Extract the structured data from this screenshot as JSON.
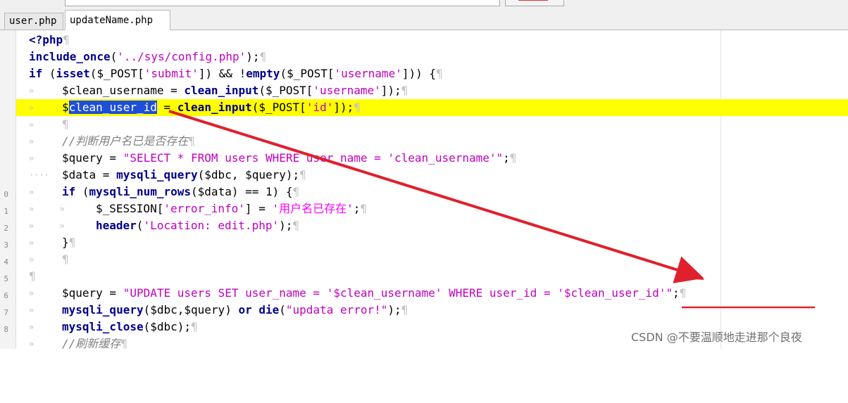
{
  "tabs": [
    {
      "label": "user.php",
      "active": false
    },
    {
      "label": "updateName.php",
      "active": true
    }
  ],
  "gutter_numbers": [
    "0",
    "1",
    "2",
    "3",
    "4",
    "5",
    "6",
    "7",
    "8"
  ],
  "code_lines": [
    "<?php",
    "include_once('../sys/config.php');",
    "if (isset($_POST['submit']) && !empty($_POST['username'])) {",
    "$clean_username = clean_input($_POST['username']);",
    "$clean_user_id = clean_input($_POST['id']);",
    "",
    "//判断用户名已是否存在",
    "$query = \"SELECT * FROM users WHERE user_name = 'clean_username'\";",
    "$data = mysqli_query($dbc, $query);",
    "if (mysqli_num_rows($data) == 1) {",
    "$_SESSION['error_info'] = '用户名已存在';",
    "header('Location: edit.php');",
    "}",
    "",
    "",
    "$query = \"UPDATE users SET user_name = '$clean_username' WHERE user_id = '$clean_user_id'\";",
    "mysqli_query($dbc,$query) or die(\"updata error!\");",
    "mysqli_close($dbc);",
    "//刷新缓存"
  ],
  "selected_text": "clean_user_id",
  "colors": {
    "highlight": "#ffff00",
    "selection": "#1e4fd6",
    "keyword": "#00008b",
    "string": "#c000c0",
    "annotation": "#e0202c"
  },
  "watermark": "CSDN @不要温顺地走进那个良夜"
}
